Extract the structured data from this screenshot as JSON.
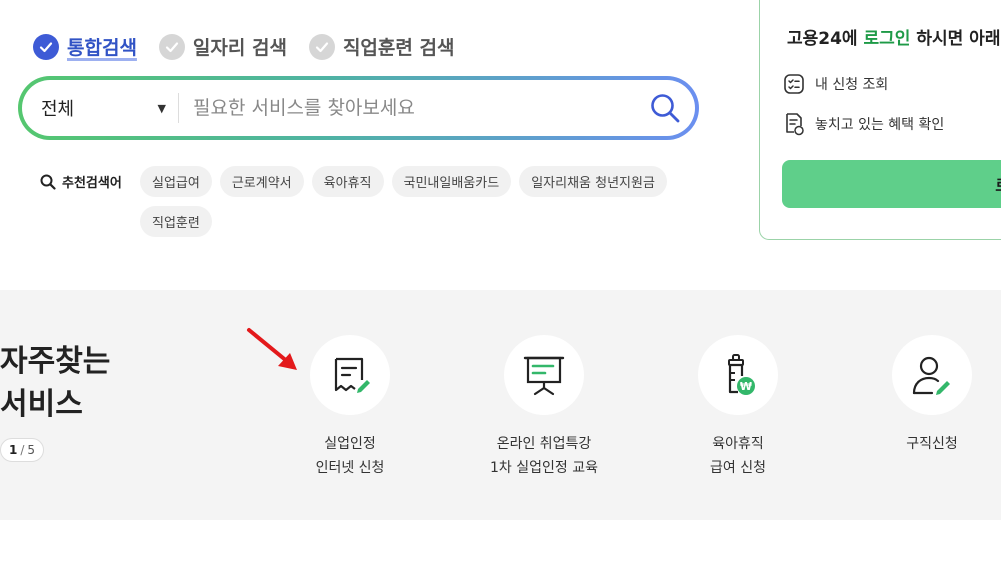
{
  "search": {
    "tabs": [
      {
        "label": "통합검색",
        "active": true
      },
      {
        "label": "일자리 검색",
        "active": false
      },
      {
        "label": "직업훈련 검색",
        "active": false
      }
    ],
    "scope_value": "전체",
    "placeholder": "필요한 서비스를 찾아보세요"
  },
  "recommend": {
    "title": "추천검색어",
    "keywords": [
      "실업급여",
      "근로계약서",
      "육아휴직",
      "국민내일배움카드",
      "일자리채움 청년지원금",
      "직업훈련"
    ]
  },
  "login_card": {
    "msg_prefix": "고용24에 ",
    "msg_login": "로그인",
    "msg_suffix": " 하시면 아래",
    "links": [
      "내 신청 조회",
      "놓치고 있는 혜택 확인"
    ],
    "button_label": "로"
  },
  "frequent": {
    "title_line1": "자주찾는",
    "title_line2": "서비스",
    "page_current": "1",
    "page_sep": "/",
    "page_total": "5",
    "services": [
      {
        "line1": "실업인정",
        "line2": "인터넷 신청",
        "icon": "certificate-pen-icon"
      },
      {
        "line1": "온라인 취업특강",
        "line2": "1차 실업인정 교육",
        "icon": "presentation-board-icon"
      },
      {
        "line1": "육아휴직",
        "line2": "급여 신청",
        "icon": "baby-bottle-won-icon"
      },
      {
        "line1": "구직신청",
        "line2": "",
        "icon": "person-pen-icon"
      }
    ]
  },
  "colors": {
    "accent_blue": "#3e5bd6",
    "brand_green": "#1e9a47",
    "login_button": "#5fcf8a",
    "icon_green": "#33b76a"
  }
}
